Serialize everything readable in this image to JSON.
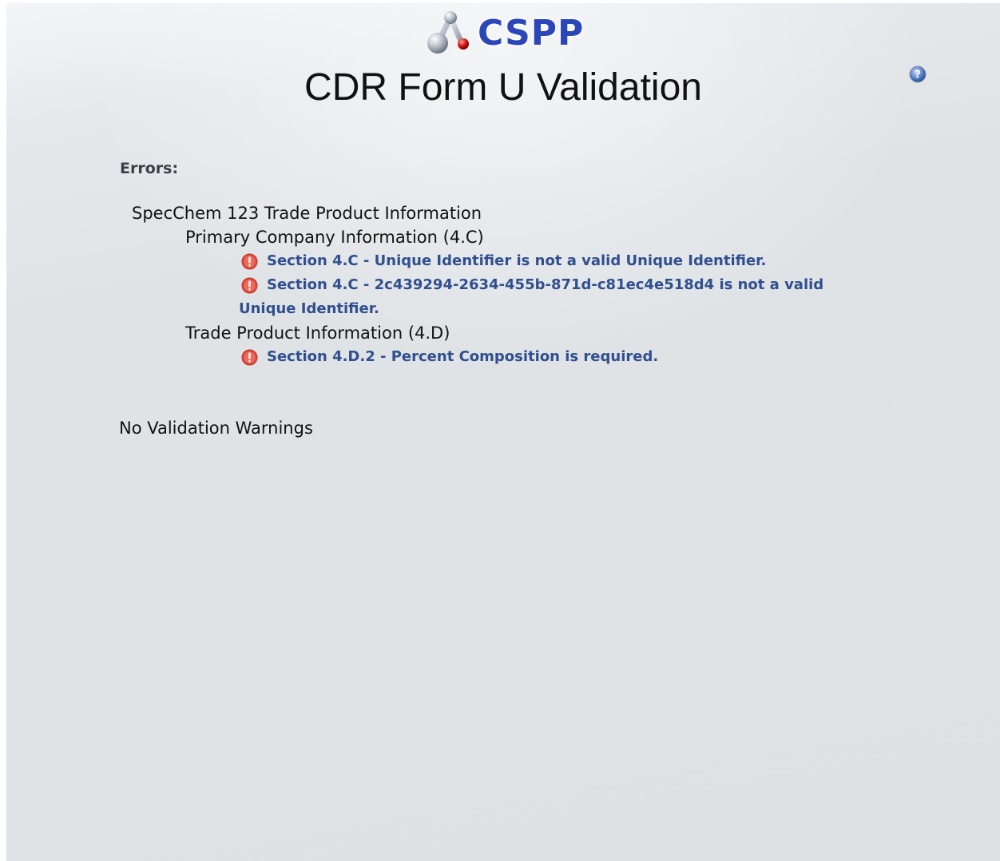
{
  "header": {
    "logo_text": "CSPP",
    "title": "CDR Form U Validation"
  },
  "errors": {
    "heading": "Errors:",
    "groups": [
      {
        "title": "SpecChem 123 Trade Product Information",
        "subgroups": [
          {
            "title": "Primary Company Information (4.C)",
            "items": [
              "Section 4.C - Unique Identifier is not a valid Unique Identifier.",
              "Section 4.C - 2c439294-2634-455b-871d-c81ec4e518d4 is not a valid Unique Identifier."
            ]
          },
          {
            "title": "Trade Product Information (4.D)",
            "items": [
              "Section 4.D.2 - Percent Composition is required."
            ]
          }
        ]
      }
    ]
  },
  "warnings": {
    "text": "No Validation Warnings"
  },
  "icons": {
    "logo": "molecule-icon",
    "help": "help-icon",
    "error": "error-icon"
  },
  "colors": {
    "logo_text": "#2a46b8",
    "error_text": "#2f4f8f",
    "error_icon": "#e24b3c"
  }
}
